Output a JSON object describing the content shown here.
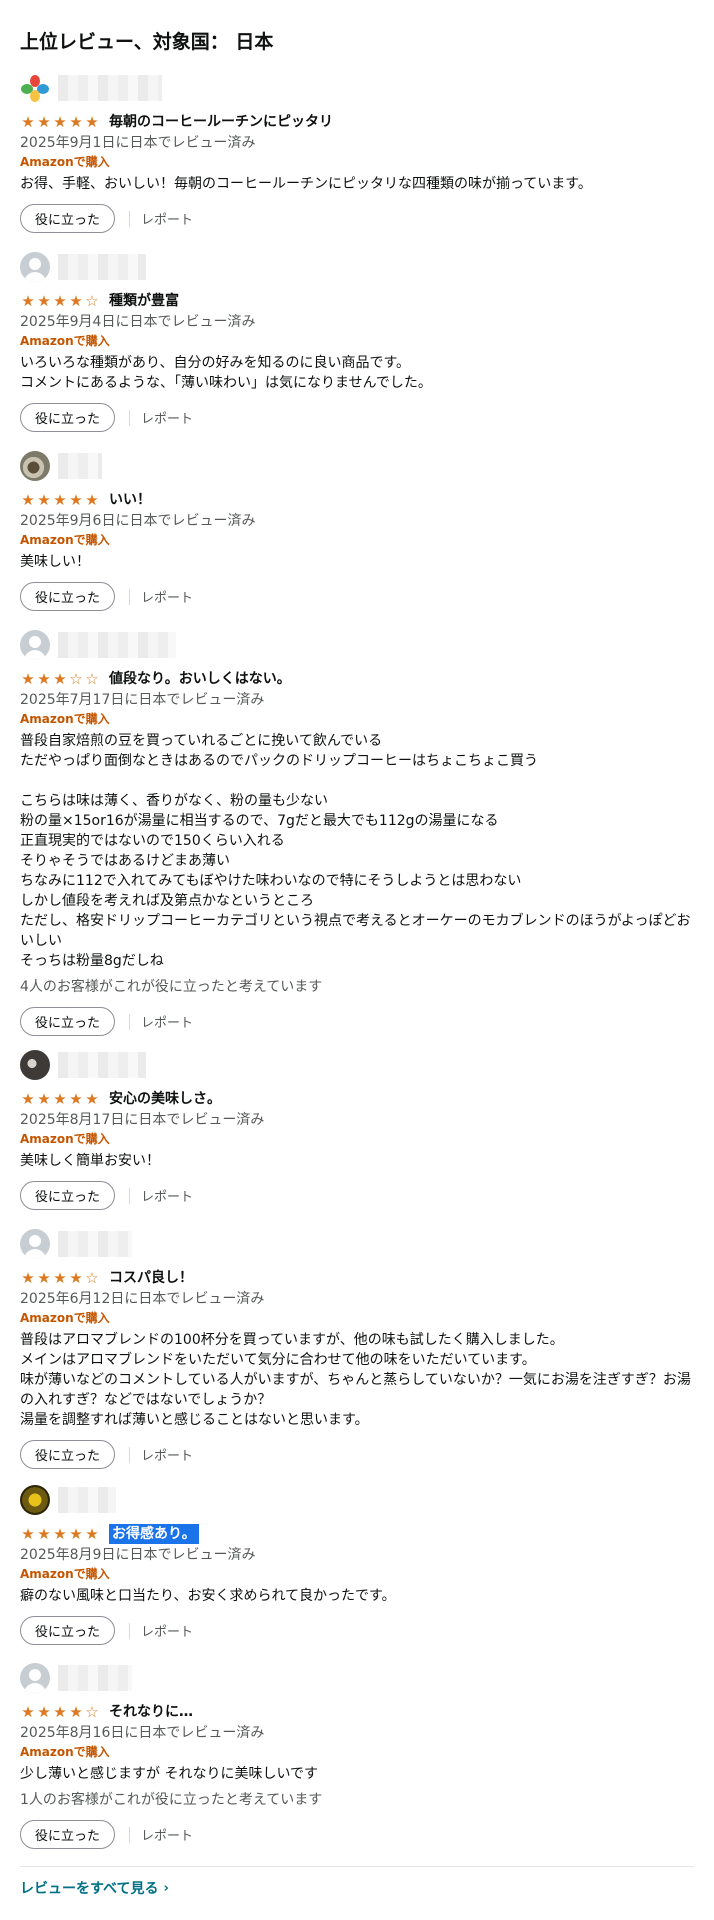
{
  "heading": "上位レビュー、対象国： 日本",
  "common": {
    "verified_purchase": "Amazonで購入",
    "helpful_button": "役に立った",
    "report_link": "レポート"
  },
  "reviews": [
    {
      "avatar": "clover-avatar",
      "rating": 5,
      "title": "毎朝のコーヒールーチンにピッタリ",
      "date": "2025年9月1日に日本でレビュー済み",
      "body": "お得、手軽、おいしい！毎朝のコーヒールーチンにピッタリな四種類の味が揃っています。",
      "helpful_count": ""
    },
    {
      "avatar": "default-avatar",
      "rating": 4,
      "title": "種類が豊富",
      "date": "2025年9月4日に日本でレビュー済み",
      "body": "いろいろな種類があり、自分の好みを知るのに良い商品です。\nコメントにあるような、「薄い味わい」は気になりませんでした。",
      "helpful_count": ""
    },
    {
      "avatar": "photo-avatar",
      "rating": 5,
      "title": "いい！",
      "date": "2025年9月6日に日本でレビュー済み",
      "body": "美味しい！",
      "helpful_count": ""
    },
    {
      "avatar": "default-avatar",
      "rating": 3,
      "title": "値段なり。おいしくはない。",
      "date": "2025年7月17日に日本でレビュー済み",
      "body": "普段自家焙煎の豆を買っていれるごとに挽いて飲んでいる\nただやっぱり面倒なときはあるのでパックのドリップコーヒーはちょこちょこ買う\n\nこちらは味は薄く、香りがなく、粉の量も少ない\n粉の量×15or16が湯量に相当するので、7gだと最大でも112gの湯量になる\n正直現実的ではないので150くらい入れる\nそりゃそうではあるけどまあ薄い\nちなみに112で入れてみてもぼやけた味わいなので特にそうしようとは思わない\nしかし値段を考えれば及第点かなというところ\nただし、格安ドリップコーヒーカテゴリという視点で考えるとオーケーのモカブレンドのほうがよっぽどおいしい\nそっちは粉量8gだしね",
      "helpful_count": "4人のお客様がこれが役に立ったと考えています"
    },
    {
      "avatar": "photo-avatar",
      "rating": 5,
      "title": "安心の美味しさ。",
      "date": "2025年8月17日に日本でレビュー済み",
      "body": "美味しく簡単お安い！",
      "helpful_count": ""
    },
    {
      "avatar": "default-avatar",
      "rating": 4,
      "title": "コスパ良し！",
      "date": "2025年6月12日に日本でレビュー済み",
      "body": "普段はアロマブレンドの100杯分を買っていますが、他の味も試したく購入しました。\nメインはアロマブレンドをいただいて気分に合わせて他の味をいただいています。\n味が薄いなどのコメントしている人がいますが、ちゃんと蒸らしていないか？一気にお湯を注ぎすぎ？お湯の入れすぎ？などではないでしょうか？\n湯量を調整すれば薄いと感じることはないと思います。",
      "helpful_count": ""
    },
    {
      "avatar": "photo-avatar",
      "rating": 5,
      "title": "お得感あり。",
      "date": "2025年8月9日に日本でレビュー済み",
      "body": "癖のない風味と口当たり、お安く求められて良かったです。",
      "helpful_count": ""
    },
    {
      "avatar": "default-avatar",
      "rating": 4,
      "title": "それなりに…",
      "date": "2025年8月16日に日本でレビュー済み",
      "body": "少し薄いと感じますが それなりに美味しいです",
      "helpful_count": "1人のお客様がこれが役に立ったと考えています"
    }
  ],
  "see_all_link": "レビューをすべて見る",
  "colors": {
    "star": "#de7921",
    "verified": "#c45500",
    "link": "#007185",
    "meta": "#565959",
    "highlight": "#1a73e8"
  }
}
